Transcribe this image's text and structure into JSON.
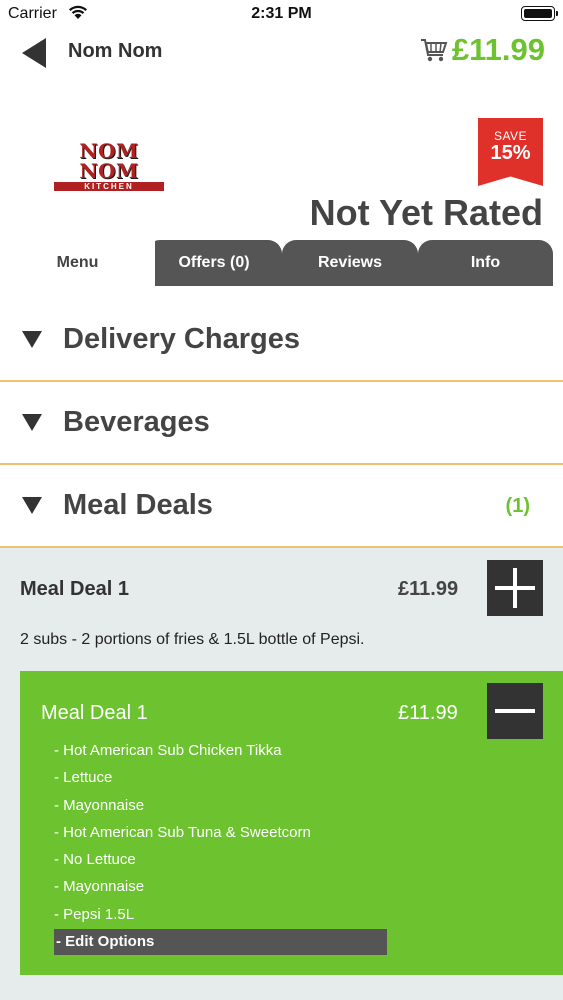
{
  "status_bar": {
    "carrier": "Carrier",
    "time": "2:31 PM"
  },
  "nav": {
    "title": "Nom Nom",
    "cart_total": "£11.99"
  },
  "restaurant": {
    "logo_text": "NOM NOM",
    "logo_subtext": "KITCHEN",
    "save_label": "SAVE",
    "save_percent": "15%",
    "rating": "Not Yet Rated"
  },
  "tabs": [
    {
      "label": "Menu"
    },
    {
      "label": "Offers (0)"
    },
    {
      "label": "Reviews"
    },
    {
      "label": "Info"
    }
  ],
  "sections": [
    {
      "title": "Delivery Charges",
      "count": ""
    },
    {
      "title": "Beverages",
      "count": ""
    },
    {
      "title": "Meal Deals",
      "count": "(1)"
    }
  ],
  "meal_item": {
    "name": "Meal Deal 1",
    "price": "£11.99",
    "description": "2 subs - 2 portions of fries & 1.5L bottle of Pepsi."
  },
  "order": {
    "name": "Meal Deal 1",
    "price": "£11.99",
    "options": [
      "- Hot American Sub Chicken Tikka",
      "- Lettuce",
      "- Mayonnaise",
      "- Hot American Sub Tuna & Sweetcorn",
      "- No Lettuce",
      "- Mayonnaise",
      "- Pepsi 1.5L"
    ],
    "edit_label": "- Edit Options"
  },
  "colors": {
    "accent_green": "#6cc32f",
    "badge_red": "#e0302a",
    "tab_dark": "#555555",
    "divider": "#f0c070"
  }
}
